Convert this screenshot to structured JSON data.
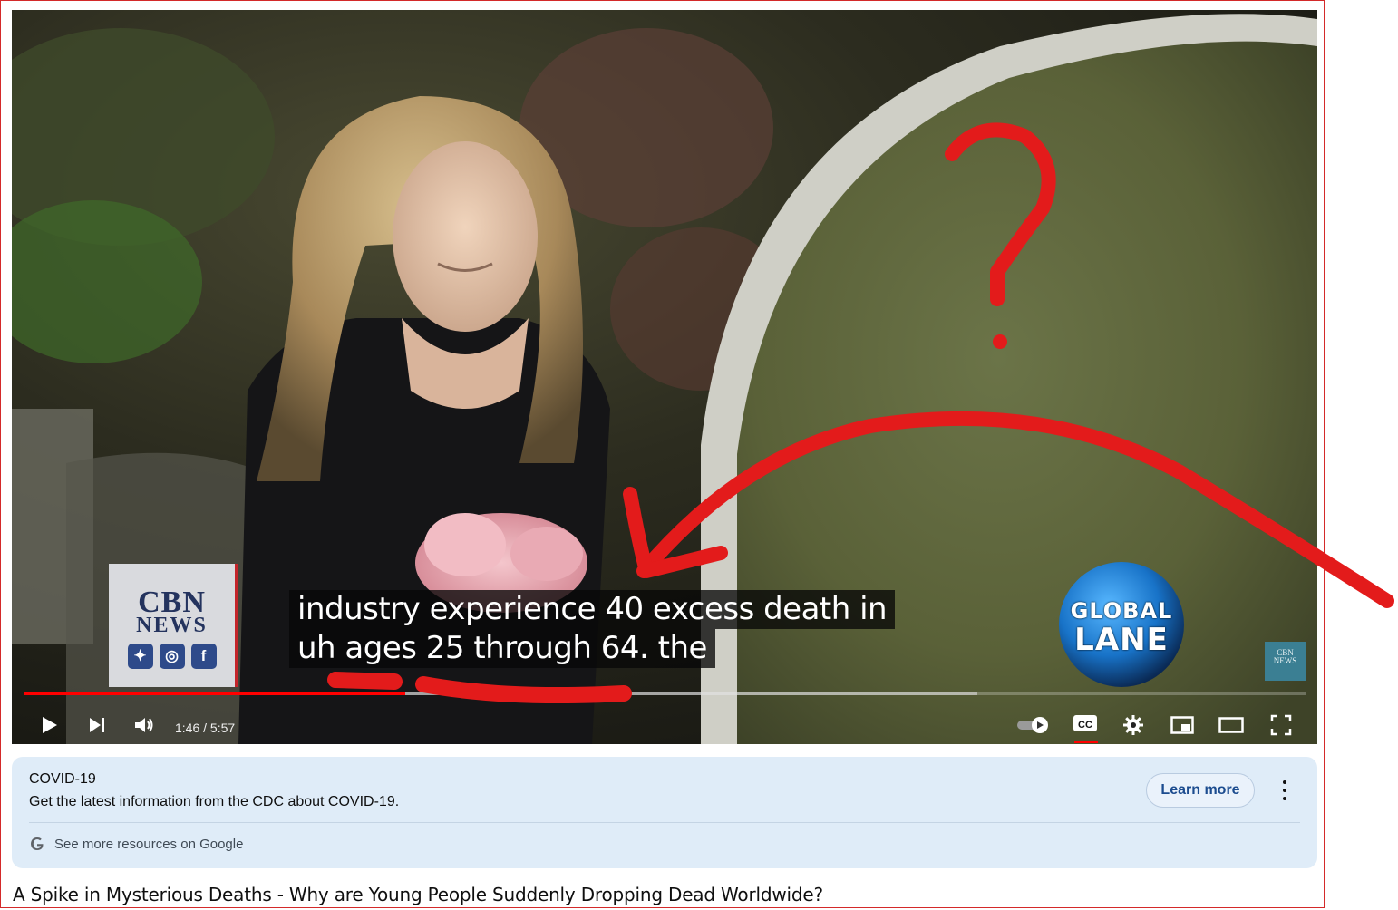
{
  "player": {
    "overlay_logo": {
      "word1": "CBN",
      "word2": "NEWS",
      "social_icons": [
        "twitter-icon",
        "instagram-icon",
        "facebook-icon"
      ]
    },
    "global_lane": {
      "line1": "GLOBAL",
      "line2": "LANE"
    },
    "watermark": {
      "line1": "CBN",
      "line2": "NEWS"
    },
    "captions": [
      "industry experience 40 excess death in",
      "uh ages 25 through 64. the"
    ],
    "time": "1:46 / 5:57",
    "progress": {
      "played_fraction": 0.297,
      "loaded_fraction": 0.744
    },
    "controls": {
      "left": [
        "play-icon",
        "next-icon",
        "volume-icon"
      ],
      "right": [
        "autoplay-toggle-icon",
        "cc-icon",
        "settings-gear-icon",
        "miniplayer-icon",
        "theater-mode-icon",
        "fullscreen-icon"
      ]
    },
    "accent_color": "#ff0000"
  },
  "annotation_color": "#e31b1b",
  "info_panel": {
    "title": "COVID-19",
    "description": "Get the latest information from the CDC about COVID-19.",
    "learn_more": "Learn more",
    "see_more": "See more resources on Google"
  },
  "video_title": "A Spike in Mysterious Deaths - Why are Young People Suddenly Dropping Dead Worldwide?"
}
